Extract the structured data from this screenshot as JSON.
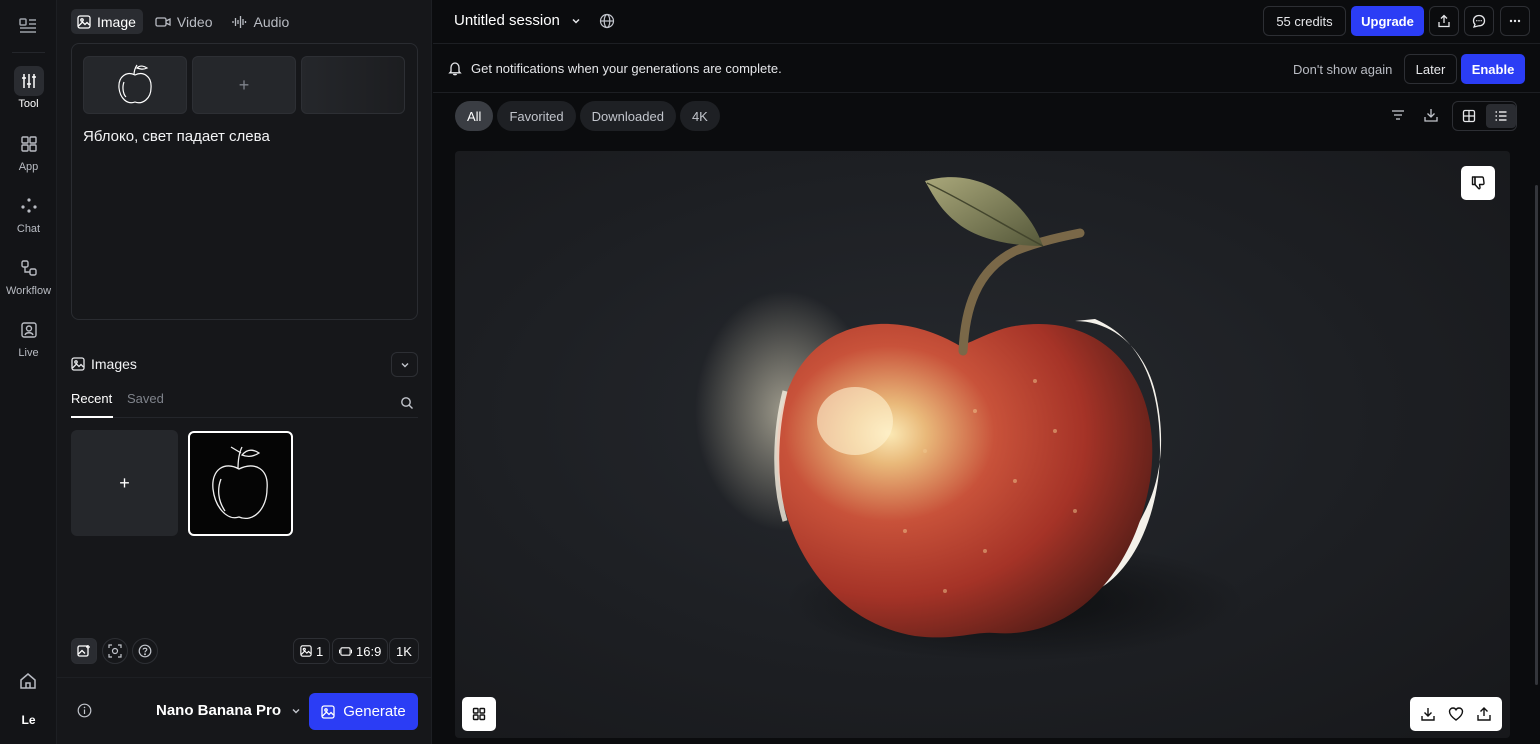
{
  "rail": {
    "items": [
      {
        "label": "Tool",
        "icon": "sliders-icon"
      },
      {
        "label": "App",
        "icon": "grid-icon"
      },
      {
        "label": "Chat",
        "icon": "dots-icon"
      },
      {
        "label": "Workflow",
        "icon": "workflow-icon"
      },
      {
        "label": "Live",
        "icon": "live-icon"
      }
    ],
    "avatar": "Le"
  },
  "panel": {
    "mode_tabs": [
      {
        "label": "Image",
        "icon": "image-icon"
      },
      {
        "label": "Video",
        "icon": "video-icon"
      },
      {
        "label": "Audio",
        "icon": "audio-wave-icon"
      }
    ],
    "add_symbol": "+",
    "prompt": "Яблоко, свет падает слева",
    "images_title": "Images",
    "sub_tabs": [
      "Recent",
      "Saved"
    ],
    "controls": {
      "count": "1",
      "aspect": "16:9",
      "resolution": "1K"
    },
    "model": "Nano Banana Pro",
    "generate": "Generate"
  },
  "topbar": {
    "session_title": "Untitled session",
    "credits": "55 credits",
    "upgrade": "Upgrade"
  },
  "notification": {
    "text": "Get notifications when your generations are complete.",
    "dont_show": "Don't show again",
    "later": "Later",
    "enable": "Enable"
  },
  "filters": [
    "All",
    "Favorited",
    "Downloaded",
    "4K"
  ],
  "colors": {
    "accent": "#2b3df5",
    "background": "#0b0c0e",
    "panel": "#16171a"
  }
}
